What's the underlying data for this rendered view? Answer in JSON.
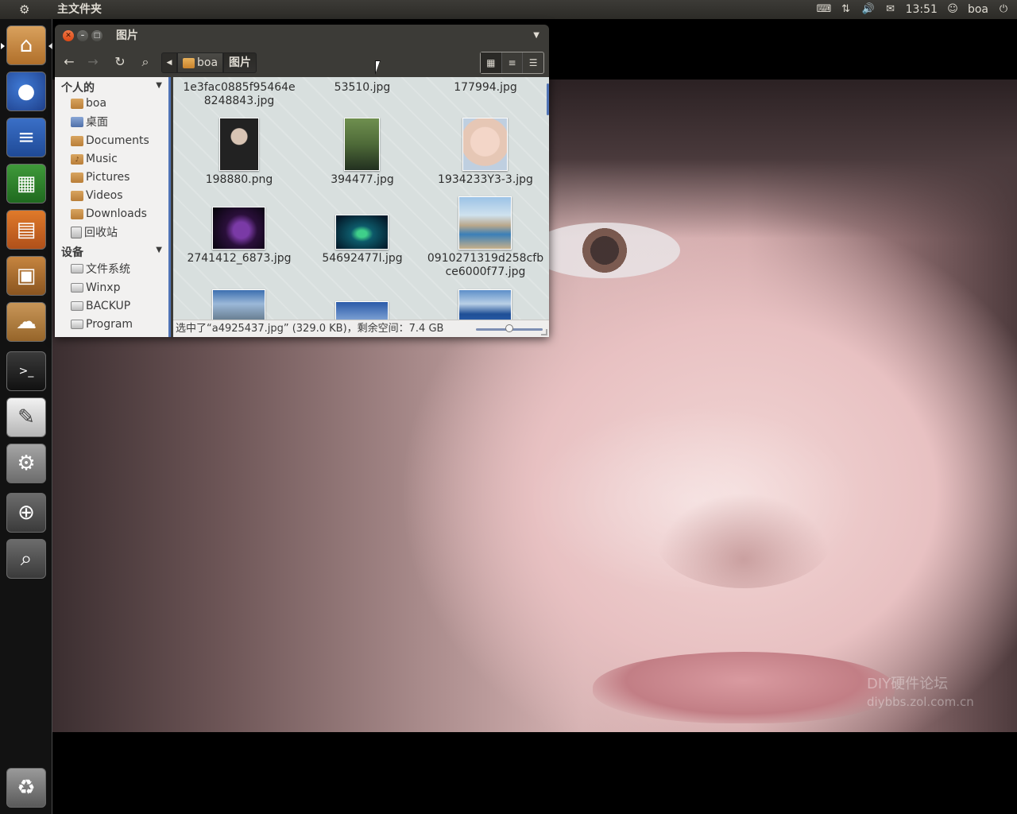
{
  "top_panel": {
    "app_title": "主文件夹",
    "clock": "13:51",
    "user": "boa",
    "icons": [
      "keyboard-icon",
      "network-icon",
      "volume-icon",
      "mail-icon",
      "user-icon",
      "power-icon"
    ]
  },
  "launcher": {
    "items": [
      "home-folder",
      "firefox",
      "libreoffice-writer",
      "libreoffice-calc",
      "libreoffice-impress",
      "ubuntu-software-center",
      "ubuntu-one",
      "terminal",
      "text-editor",
      "system-settings",
      "workspace-switcher",
      "dash-search",
      "trash"
    ]
  },
  "window": {
    "title": "图片",
    "breadcrumbs": [
      "boa",
      "图片"
    ],
    "sidebar": {
      "personal_header": "个人的",
      "personal_items": [
        "boa",
        "桌面",
        "Documents",
        "Music",
        "Pictures",
        "Videos",
        "Downloads",
        "回收站"
      ],
      "devices_header": "设备",
      "device_items": [
        "文件系统",
        "Winxp",
        "BACKUP",
        "Program"
      ]
    },
    "files": [
      {
        "name": "1e3fac0885f95464e\n8248843.jpg"
      },
      {
        "name": "53510.jpg"
      },
      {
        "name": "177994.jpg"
      },
      {
        "name": "198880.png"
      },
      {
        "name": "394477.jpg"
      },
      {
        "name": "1934233Y3-3.jpg"
      },
      {
        "name": "2741412_6873.jpg"
      },
      {
        "name": "54692477l.jpg"
      },
      {
        "name": "0910271319d258cfb\nce6000f77.jpg"
      }
    ],
    "status": "选中了“a4925437.jpg” (329.0 KB)，剩余空间：7.4 GB",
    "zoom_level": 0.5
  },
  "wallpaper": {
    "watermark_line1": "DIY硬件论坛",
    "watermark_line2": "diybbs.zol.com.cn"
  }
}
